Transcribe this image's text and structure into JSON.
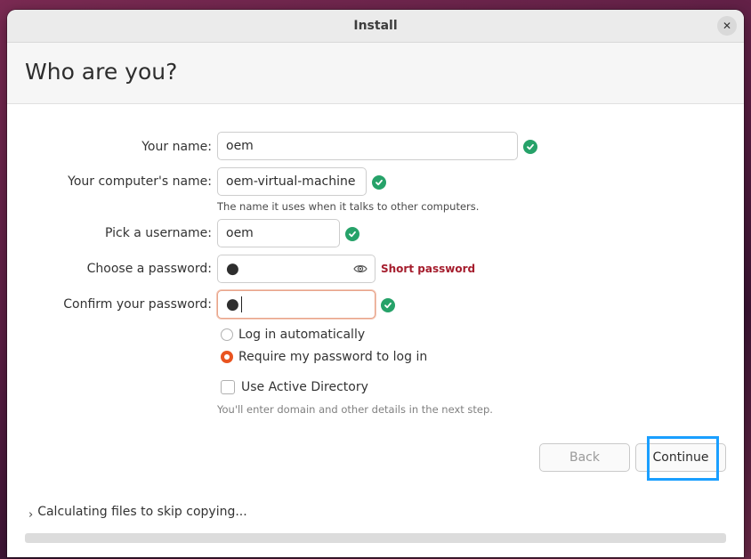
{
  "window": {
    "title": "Install",
    "close_icon": "close-icon"
  },
  "header": {
    "title": "Who are you?"
  },
  "form": {
    "name": {
      "label": "Your name:",
      "value": "oem",
      "valid": true
    },
    "computer_name": {
      "label": "Your computer's name:",
      "value": "oem-virtual-machine",
      "hint": "The name it uses when it talks to other computers.",
      "valid": true
    },
    "username": {
      "label": "Pick a username:",
      "value": "oem",
      "valid": true
    },
    "password": {
      "label": "Choose a password:",
      "value": "●",
      "warning": "Short password",
      "reveal_icon": "eye-icon"
    },
    "confirm_password": {
      "label": "Confirm your password:",
      "value": "●",
      "valid": true
    },
    "login_options": [
      {
        "label": "Log in automatically",
        "selected": false
      },
      {
        "label": "Require my password to log in",
        "selected": true
      }
    ],
    "active_directory": {
      "label": "Use Active Directory",
      "checked": false,
      "hint": "You'll enter domain and other details in the next step."
    }
  },
  "buttons": {
    "back": "Back",
    "continue": "Continue"
  },
  "status": {
    "text": "Calculating files to skip copying...",
    "progress": 0
  },
  "colors": {
    "accent": "#e95420",
    "valid": "#26a269",
    "warning": "#a51d2d",
    "highlight": "#1a9fff"
  }
}
